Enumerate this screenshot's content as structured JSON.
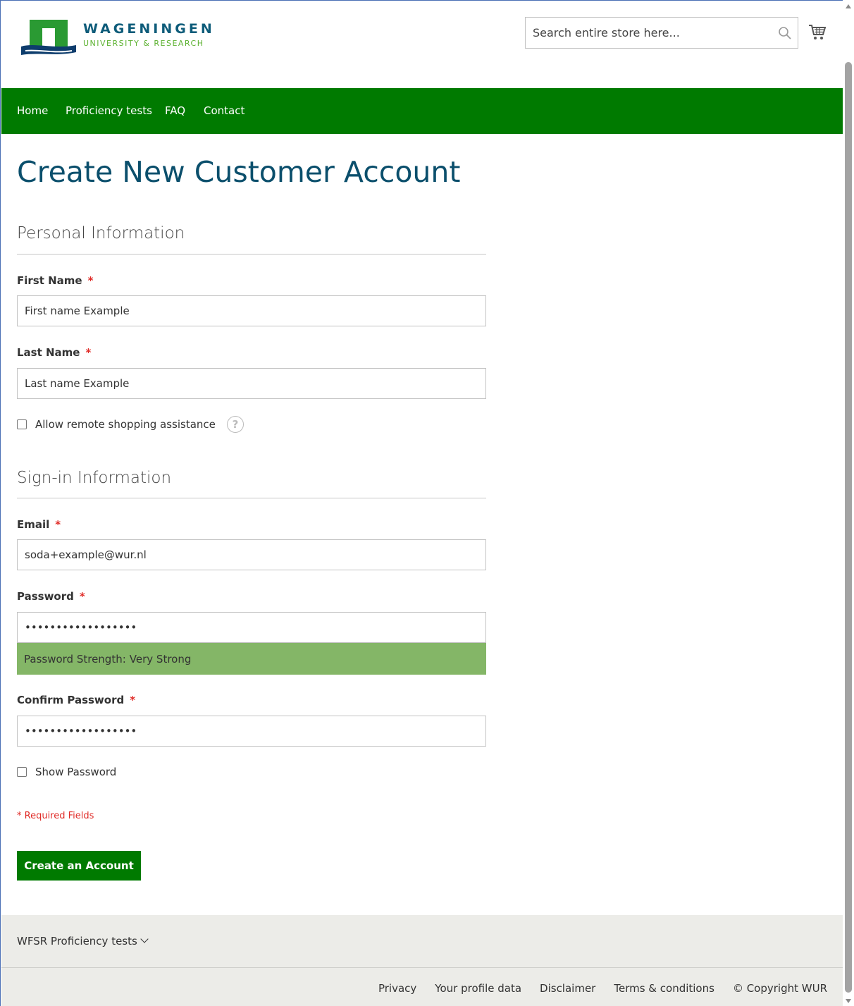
{
  "header": {
    "logo": {
      "title": "WAGENINGEN",
      "subtitle": "UNIVERSITY & RESEARCH"
    },
    "search": {
      "placeholder": "Search entire store here..."
    }
  },
  "nav": {
    "items": [
      {
        "label": "Home"
      },
      {
        "label": "Proficiency tests"
      },
      {
        "label": "FAQ"
      },
      {
        "label": "Contact"
      }
    ]
  },
  "page": {
    "title": "Create New Customer Account",
    "personal_section": {
      "title": "Personal Information",
      "first_name": {
        "label": "First Name",
        "value": "First name Example"
      },
      "last_name": {
        "label": "Last Name",
        "value": "Last name Example"
      },
      "remote_assistance": {
        "label": "Allow remote shopping assistance",
        "checked": false
      }
    },
    "signin_section": {
      "title": "Sign-in Information",
      "email": {
        "label": "Email",
        "value": "soda+example@wur.nl"
      },
      "password": {
        "label": "Password",
        "value": "••••••••••••••••••"
      },
      "strength": {
        "label": "Password Strength:",
        "value": "Very Strong"
      },
      "confirm_password": {
        "label": "Confirm Password",
        "value": "••••••••••••••••••"
      },
      "show_password": {
        "label": "Show Password",
        "checked": false
      }
    },
    "required_marker": "*",
    "required_note": "* Required Fields",
    "submit_label": "Create an Account"
  },
  "footer": {
    "toggle_label": "WFSR Proficiency tests",
    "links": [
      {
        "label": "Privacy"
      },
      {
        "label": "Your profile data"
      },
      {
        "label": "Disclaimer"
      },
      {
        "label": "Terms & conditions"
      },
      {
        "label": "© Copyright WUR"
      }
    ]
  },
  "colors": {
    "brand_green": "#007a00",
    "title_blue": "#0b4f6c",
    "strength_green": "#84b667",
    "required_red": "#e02b27"
  }
}
